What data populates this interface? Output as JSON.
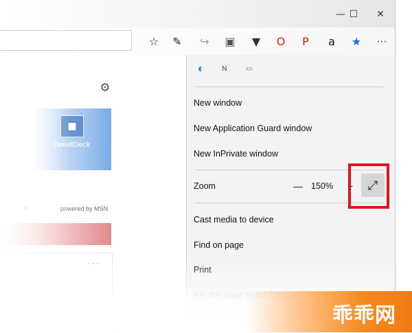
{
  "titlebar": {
    "minimize_glyph": "—",
    "maximize_glyph": "☐",
    "close_glyph": "✕"
  },
  "toolbar": {
    "icons": [
      {
        "name": "favorites-star-icon",
        "glyph": "☆",
        "color": "#222222"
      },
      {
        "name": "pen-icon",
        "glyph": "✎",
        "color": "#222222"
      },
      {
        "name": "share-icon",
        "glyph": "↪",
        "color": "#9a9a9a"
      },
      {
        "name": "lock-bag-icon",
        "glyph": "▣",
        "color": "#555555"
      },
      {
        "name": "pocket-icon",
        "glyph": "▼",
        "color": "#333333"
      },
      {
        "name": "opera-icon",
        "glyph": "O",
        "color": "#e2231a"
      },
      {
        "name": "pinterest-icon",
        "glyph": "P",
        "color": "#cb2027"
      },
      {
        "name": "amazon-icon",
        "glyph": "a",
        "color": "#111111"
      },
      {
        "name": "ribbon-icon",
        "glyph": "★",
        "color": "#1f6fd0"
      },
      {
        "name": "more-icon",
        "glyph": "···",
        "color": "#1f6fd0"
      }
    ]
  },
  "newtab": {
    "tile_label": "TweetDeck",
    "tile_logo_glyph": "■",
    "settings_glyph": "⚙",
    "powered_by": "powered by MSN",
    "card_more": "···"
  },
  "menu": {
    "top_icons": [
      {
        "name": "extensions-icon",
        "glyph": "◖",
        "color": "#1a9cd8"
      },
      {
        "name": "onenote-icon",
        "glyph": "N",
        "color": "#7b2c9e"
      },
      {
        "name": "notes-icon",
        "glyph": "▭",
        "color": "#2a7bd3"
      }
    ],
    "items_group1": [
      "New window",
      "New Application Guard window",
      "New InPrivate window"
    ],
    "zoom": {
      "label": "Zoom",
      "minus": "—",
      "value": "150%",
      "plus": "+",
      "fullscreen_glyph": "⤢"
    },
    "items_group2": [
      "Cast media to device",
      "Find on page",
      "Print",
      "Pin this page to the taskbar"
    ]
  },
  "watermark": {
    "text": "乖乖网"
  },
  "colors": {
    "highlight": "#e0141c",
    "menu_bg": "#f3f3f3",
    "accent": "#1f6fd0"
  }
}
